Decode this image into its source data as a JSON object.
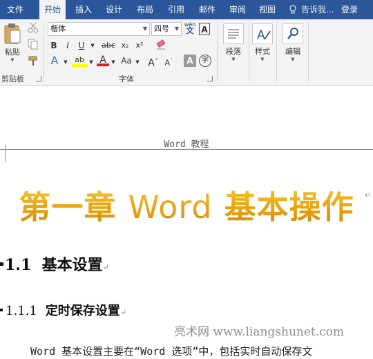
{
  "tabs": [
    {
      "label": "文件",
      "active": false
    },
    {
      "label": "开始",
      "active": true
    },
    {
      "label": "插入",
      "active": false
    },
    {
      "label": "设计",
      "active": false
    },
    {
      "label": "布局",
      "active": false
    },
    {
      "label": "引用",
      "active": false
    },
    {
      "label": "邮件",
      "active": false
    },
    {
      "label": "审阅",
      "active": false
    },
    {
      "label": "视图",
      "active": false
    }
  ],
  "tell_me": "告诉我...",
  "login": "登录",
  "ribbon": {
    "clipboard": {
      "paste_label": "粘贴",
      "group_label": "剪贴板"
    },
    "font": {
      "font_name": "楷体",
      "font_size": "四号",
      "wen_glyph": "wén",
      "bold": "B",
      "italic": "I",
      "underline": "U",
      "strike": "abc",
      "subscript": "x₂",
      "superscript": "x²",
      "text_effect": "A",
      "highlight": "ab",
      "font_color": "A",
      "change_case": "Aa",
      "grow": "A",
      "shrink": "A",
      "char_shading": "A",
      "enclose": "字",
      "char_border": "A",
      "group_label": "字体"
    },
    "paragraph_label": "段落",
    "styles_label": "样式",
    "editing_label": "编辑"
  },
  "colors": {
    "tab_bar": "#2b579a",
    "ribbon_bg": "#f3f3f3",
    "title_gold": "#e7a412",
    "highlight_yellow": "#ffff00",
    "font_red": "#e02020"
  },
  "document": {
    "header": "Word 教程",
    "title_part1": "第一章",
    "title_word": "Word",
    "title_part2": "基本操作",
    "h2_number": "1.1",
    "h2_text": "基本设置",
    "h3_number": "1.1.1",
    "h3_text": "定时保存设置",
    "watermark": "亮术网 www.liangshunet.com",
    "body": "Word 基本设置主要在“Word 选项”中，包括实时自动保存文"
  }
}
